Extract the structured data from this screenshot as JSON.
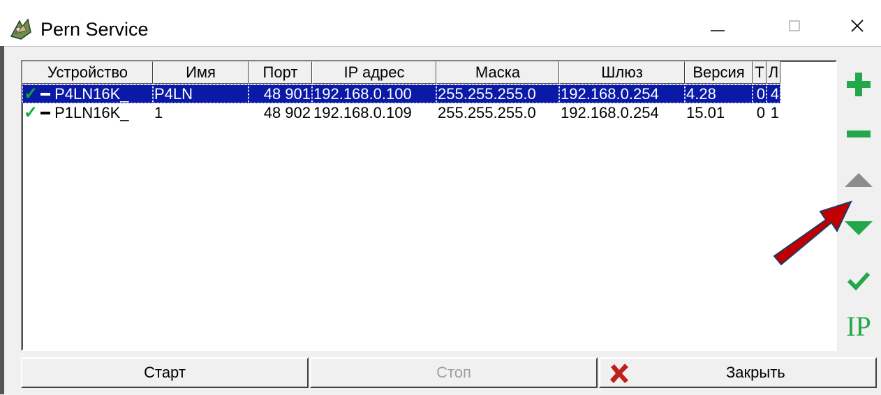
{
  "window": {
    "title": "Pern Service",
    "min_glyph": "—",
    "max_glyph": "☐",
    "close_glyph": "✕"
  },
  "table": {
    "columns": [
      "Устройство",
      "Имя",
      "Порт",
      "IP адрес",
      "Маска",
      "Шлюз",
      "Версия",
      "Т",
      "Л"
    ],
    "rows": [
      {
        "selected": true,
        "status_icon": "check-icon",
        "device": "P4LN16K_",
        "name": "P4LN",
        "port": "48 901",
        "ip": "192.168.0.100",
        "mask": "255.255.255.0",
        "gateway": "192.168.0.254",
        "version": "4.28",
        "t": "0",
        "l": "4"
      },
      {
        "selected": false,
        "status_icon": "check-icon",
        "device": "P1LN16K_",
        "name": "1",
        "port": "48 902",
        "ip": "192.168.0.109",
        "mask": "255.255.255.0",
        "gateway": "192.168.0.254",
        "version": "15.01",
        "t": "0",
        "l": "1"
      }
    ]
  },
  "toolbar": {
    "items": [
      "add-icon",
      "remove-icon",
      "move-up-icon",
      "move-down-icon",
      "check-icon",
      "ip-icon"
    ],
    "ip_label": "IP",
    "accent_color": "#22a84a",
    "disabled_color": "#8c8c8c"
  },
  "buttons": {
    "start": "Старт",
    "stop": "Стоп",
    "close": "Закрыть"
  },
  "colors": {
    "selection": "#0a1aa6",
    "annotation_arrow": "#c00000"
  }
}
